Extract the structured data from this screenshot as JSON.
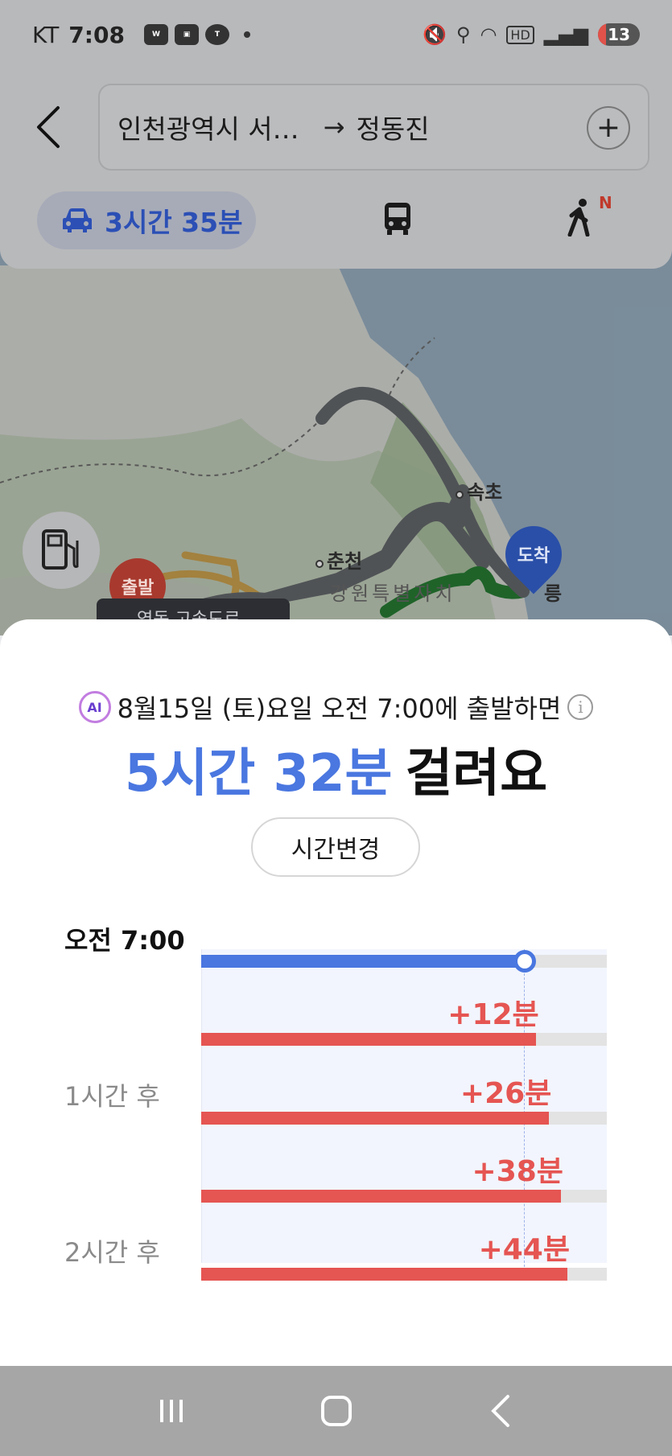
{
  "status_bar": {
    "carrier": "KT",
    "time": "7:08",
    "battery": "13",
    "app_icons": [
      "webtoon-icon",
      "scan-icon",
      "talk-icon"
    ]
  },
  "route": {
    "from": "인천광역시 서…",
    "arrow": "→",
    "to": "정동진",
    "add_label": "+"
  },
  "modes": {
    "car_label": "3시간 35분",
    "walk_badge": "N"
  },
  "map": {
    "labels": {
      "sokcho": "속초",
      "chuncheon": "춘천",
      "gangwon": "강원특별자치",
      "start": "출발",
      "end": "도착",
      "road": "영동 고속도로",
      "gangneung_frag": "릉"
    }
  },
  "sheet": {
    "ai_badge": "AI",
    "depart_text": "8월15일 (토)요일 오전 7:00에 출발하면",
    "info_icon": "i",
    "duration_value": "5시간 32분",
    "duration_suffix": "걸려요",
    "change_button": "시간변경"
  },
  "chart_data": {
    "type": "bar",
    "rows": [
      {
        "label": "오전 7:00",
        "delta": "",
        "fill": 0.797
      },
      {
        "label": "",
        "delta": "+12분",
        "fill": 0.826
      },
      {
        "label": "1시간 후",
        "delta": "+26분",
        "fill": 0.857
      },
      {
        "label": "",
        "delta": "+38분",
        "fill": 0.886
      },
      {
        "label": "2시간 후",
        "delta": "+44분",
        "fill": 0.902
      }
    ],
    "colors": {
      "base": "#4a77e0",
      "later": "#e55552",
      "track": "#e3e3e3"
    }
  },
  "nav": [
    "recent-apps-icon",
    "home-icon",
    "back-icon"
  ]
}
